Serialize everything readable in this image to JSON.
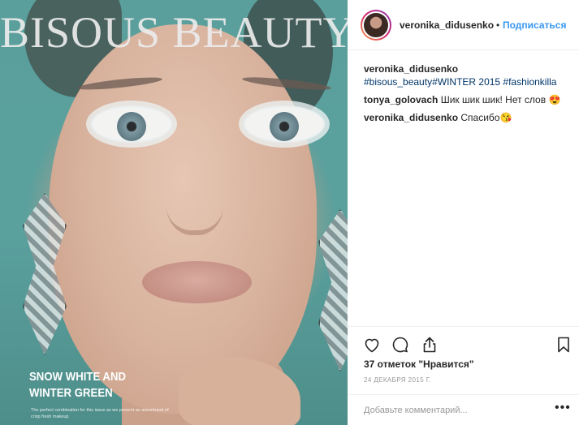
{
  "post": {
    "cover_title": "BISOUS BEAUTY",
    "cover_headline": "SNOW WHITE AND WINTER GREEN",
    "cover_tagline": "The perfect combination for this issue as we present an assortment of crisp fresh makeup"
  },
  "header": {
    "username": "veronika_didusenko",
    "separator": "•",
    "follow_label": "Подписаться"
  },
  "comments": [
    {
      "user": "veronika_didusenko",
      "text": "#bisous_beauty#WINTER 2015 #fashionkilla"
    },
    {
      "user": "tonya_golovach",
      "text": "Шик шик шик! Нет слов 😍"
    },
    {
      "user": "veronika_didusenko",
      "text": "Спасибо😘"
    }
  ],
  "actions": {
    "like_icon": "heart-icon",
    "comment_icon": "comment-bubble-icon",
    "share_icon": "share-icon",
    "save_icon": "bookmark-icon"
  },
  "likes_text": "37 отметок \"Нравится\"",
  "date_text": "24 ДЕКАБРЯ 2015 Г.",
  "add_comment": {
    "placeholder": "Добавьте комментарий...",
    "more_label": "•••"
  },
  "colors": {
    "link_blue": "#3897f0",
    "hashtag_blue": "#003569",
    "text": "#262626",
    "muted": "#999999"
  }
}
